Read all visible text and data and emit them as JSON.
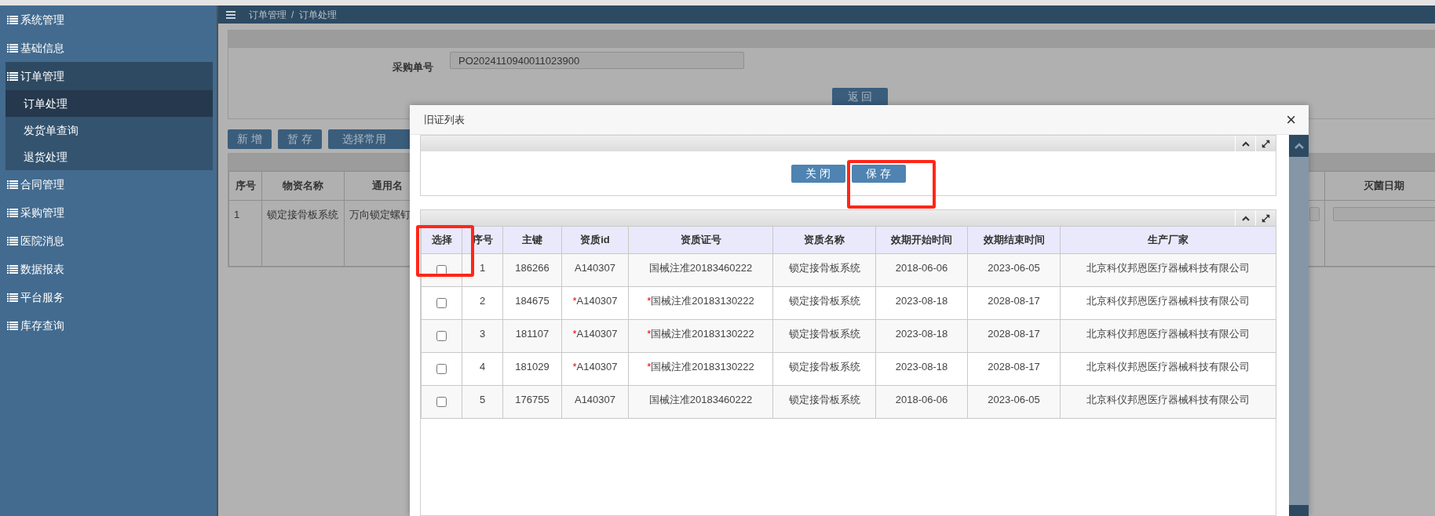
{
  "sidebar": {
    "items": [
      {
        "label": "系统管理",
        "expanded": false
      },
      {
        "label": "基础信息",
        "expanded": false
      },
      {
        "label": "订单管理",
        "expanded": true,
        "children": [
          {
            "label": "订单处理",
            "selected": true
          },
          {
            "label": "发货单查询",
            "selected": false
          },
          {
            "label": "退货处理",
            "selected": false
          }
        ]
      },
      {
        "label": "合同管理",
        "expanded": false
      },
      {
        "label": "采购管理",
        "expanded": false
      },
      {
        "label": "医院消息",
        "expanded": false
      },
      {
        "label": "数据报表",
        "expanded": false
      },
      {
        "label": "平台服务",
        "expanded": false
      },
      {
        "label": "库存查询",
        "expanded": false
      }
    ]
  },
  "breadcrumb": [
    "订单管理",
    "/",
    "订单处理"
  ],
  "order_form": {
    "label": "采购单号",
    "value": "PO2024110940011023900",
    "back_button": "返 回"
  },
  "toolbar": [
    "新 增",
    "暂 存",
    "选择常用"
  ],
  "items_table": {
    "columns": [
      "序号",
      "物资名称",
      "通用名",
      "灭菌日期"
    ],
    "rows": [
      [
        "1",
        "锁定接骨板系统",
        "万向锁定螺钉"
      ]
    ]
  },
  "modal": {
    "title": "旧证列表",
    "close": "×",
    "buttons": [
      {
        "label": "关 闭",
        "highlighted": false
      },
      {
        "label": "保 存",
        "highlighted": true
      }
    ],
    "table": {
      "columns": [
        {
          "label": "选择",
          "highlighted": true
        },
        {
          "label": "序号",
          "highlighted": false
        },
        {
          "label": "主键",
          "highlighted": false
        },
        {
          "label": "资质id",
          "highlighted": false
        },
        {
          "label": "资质证号",
          "highlighted": false
        },
        {
          "label": "资质名称",
          "highlighted": false
        },
        {
          "label": "效期开始时间",
          "highlighted": false
        },
        {
          "label": "效期结束时间",
          "highlighted": false
        },
        {
          "label": "生产厂家",
          "highlighted": false
        }
      ],
      "rows": [
        {
          "checked": false,
          "no": "1",
          "key": "186266",
          "cert_id": "A140307",
          "cert_no": "国械注准20183460222",
          "cert_name": "锁定接骨板系统",
          "start": "2018-06-06",
          "end": "2023-06-05",
          "maker": "北京科仪邦恩医疗器械科技有限公司"
        },
        {
          "checked": false,
          "no": "2",
          "key": "184675",
          "cert_id_mark": "*",
          "cert_id": "A140307",
          "cert_no_mark": "*",
          "cert_no": "国械注准20183130222",
          "cert_name": "锁定接骨板系统",
          "start": "2023-08-18",
          "end": "2028-08-17",
          "maker": "北京科仪邦恩医疗器械科技有限公司"
        },
        {
          "checked": false,
          "no": "3",
          "key": "181107",
          "cert_id_mark": "*",
          "cert_id": "A140307",
          "cert_no_mark": "*",
          "cert_no": "国械注准20183130222",
          "cert_name": "锁定接骨板系统",
          "start": "2023-08-18",
          "end": "2028-08-17",
          "maker": "北京科仪邦恩医疗器械科技有限公司"
        },
        {
          "checked": false,
          "no": "4",
          "key": "181029",
          "cert_id_mark": "*",
          "cert_id": "A140307",
          "cert_no_mark": "*",
          "cert_no": "国械注准20183130222",
          "cert_name": "锁定接骨板系统",
          "start": "2023-08-18",
          "end": "2028-08-17",
          "maker": "北京科仪邦恩医疗器械科技有限公司"
        },
        {
          "checked": false,
          "no": "5",
          "key": "176755",
          "cert_id": "A140307",
          "cert_no": "国械注准20183460222",
          "cert_name": "锁定接骨板系统",
          "start": "2018-06-06",
          "end": "2023-06-05",
          "maker": "北京科仪邦恩医疗器械科技有限公司"
        }
      ]
    }
  }
}
